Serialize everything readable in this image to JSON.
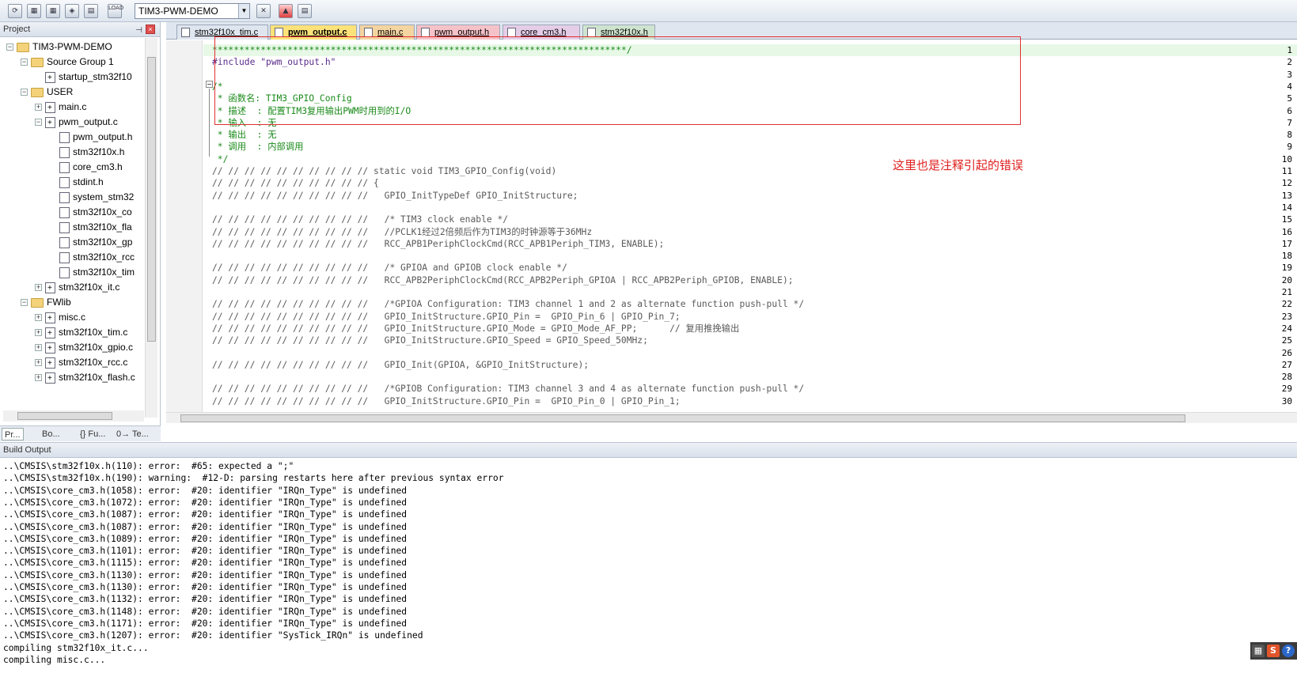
{
  "toolbar": {
    "target": "TIM3-PWM-DEMO",
    "icons": [
      "translate-icon",
      "build-icon",
      "rebuild-icon",
      "batch-build-icon",
      "stop-build-icon",
      "load-icon",
      "options-icon",
      "manage-components-icon",
      "multi-project-icon"
    ],
    "load_label": "LOAD"
  },
  "project_panel": {
    "title": "Project",
    "tree": [
      {
        "label": "TIM3-PWM-DEMO",
        "level": 0,
        "type": "project",
        "exp": "−"
      },
      {
        "label": "Source Group 1",
        "level": 1,
        "type": "folder",
        "exp": "−"
      },
      {
        "label": "startup_stm32f10",
        "level": 2,
        "type": "file",
        "exp": ""
      },
      {
        "label": "USER",
        "level": 1,
        "type": "folder",
        "exp": "−"
      },
      {
        "label": "main.c",
        "level": 2,
        "type": "file",
        "exp": "+"
      },
      {
        "label": "pwm_output.c",
        "level": 2,
        "type": "file",
        "exp": "−"
      },
      {
        "label": "pwm_output.h",
        "level": 3,
        "type": "header",
        "exp": ""
      },
      {
        "label": "stm32f10x.h",
        "level": 3,
        "type": "header",
        "exp": ""
      },
      {
        "label": "core_cm3.h",
        "level": 3,
        "type": "header",
        "exp": ""
      },
      {
        "label": "stdint.h",
        "level": 3,
        "type": "header",
        "exp": ""
      },
      {
        "label": "system_stm32",
        "level": 3,
        "type": "header",
        "exp": ""
      },
      {
        "label": "stm32f10x_co",
        "level": 3,
        "type": "header",
        "exp": ""
      },
      {
        "label": "stm32f10x_fla",
        "level": 3,
        "type": "header",
        "exp": ""
      },
      {
        "label": "stm32f10x_gp",
        "level": 3,
        "type": "header",
        "exp": ""
      },
      {
        "label": "stm32f10x_rcc",
        "level": 3,
        "type": "header",
        "exp": ""
      },
      {
        "label": "stm32f10x_tim",
        "level": 3,
        "type": "header",
        "exp": ""
      },
      {
        "label": "stm32f10x_it.c",
        "level": 2,
        "type": "file",
        "exp": "+"
      },
      {
        "label": "FWlib",
        "level": 1,
        "type": "folder",
        "exp": "−"
      },
      {
        "label": "misc.c",
        "level": 2,
        "type": "file",
        "exp": "+"
      },
      {
        "label": "stm32f10x_tim.c",
        "level": 2,
        "type": "file",
        "exp": "+"
      },
      {
        "label": "stm32f10x_gpio.c",
        "level": 2,
        "type": "file",
        "exp": "+"
      },
      {
        "label": "stm32f10x_rcc.c",
        "level": 2,
        "type": "file",
        "exp": "+"
      },
      {
        "label": "stm32f10x_flash.c",
        "level": 2,
        "type": "file",
        "exp": "+"
      }
    ],
    "bottom_tabs": [
      "Pr...",
      "Bo...",
      "{} Fu...",
      "0→ Te..."
    ]
  },
  "editor_tabs": [
    {
      "label": "stm32f10x_tim.c",
      "active": false,
      "color": "#dfe6ef"
    },
    {
      "label": "pwm_output.c",
      "active": true,
      "color": "#fde27a"
    },
    {
      "label": "main.c",
      "active": false,
      "color": "#f4d4a0"
    },
    {
      "label": "pwm_output.h",
      "active": false,
      "color": "#f5c2c8"
    },
    {
      "label": "core_cm3.h",
      "active": false,
      "color": "#e5cde8"
    },
    {
      "label": "stm32f10x.h",
      "active": false,
      "color": "#cfe4cf"
    }
  ],
  "code_lines": [
    {
      "n": "1",
      "text": "*****************************************************************************/",
      "cls": "c-cm"
    },
    {
      "n": "2",
      "text": "#include \"pwm_output.h\"",
      "cls": "c-pp"
    },
    {
      "n": "3",
      "text": "",
      "cls": ""
    },
    {
      "n": "4",
      "text": "/*",
      "cls": "c-cm"
    },
    {
      "n": "5",
      "text": " * 函数名: TIM3_GPIO_Config",
      "cls": "c-cm"
    },
    {
      "n": "6",
      "text": " * 描述  : 配置TIM3复用输出PWM时用到的I/O",
      "cls": "c-cm"
    },
    {
      "n": "7",
      "text": " * 输入  : 无",
      "cls": "c-cm"
    },
    {
      "n": "8",
      "text": " * 输出  : 无",
      "cls": "c-cm"
    },
    {
      "n": "9",
      "text": " * 调用  : 内部调用",
      "cls": "c-cm"
    },
    {
      "n": "10",
      "text": " */",
      "cls": "c-cm"
    },
    {
      "n": "11",
      "text": "// // // // // // // // // // static void TIM3_GPIO_Config(void)",
      "cls": "c-com"
    },
    {
      "n": "12",
      "text": "// // // // // // // // // // {",
      "cls": "c-com"
    },
    {
      "n": "13",
      "text": "// // // // // // // // // //   GPIO_InitTypeDef GPIO_InitStructure;",
      "cls": "c-com"
    },
    {
      "n": "14",
      "text": "",
      "cls": ""
    },
    {
      "n": "15",
      "text": "// // // // // // // // // //   /* TIM3 clock enable */",
      "cls": "c-com"
    },
    {
      "n": "16",
      "text": "// // // // // // // // // //   //PCLK1经过2倍频后作为TIM3的时钟源等于36MHz",
      "cls": "c-com"
    },
    {
      "n": "17",
      "text": "// // // // // // // // // //   RCC_APB1PeriphClockCmd(RCC_APB1Periph_TIM3, ENABLE);",
      "cls": "c-com"
    },
    {
      "n": "18",
      "text": "",
      "cls": ""
    },
    {
      "n": "19",
      "text": "// // // // // // // // // //   /* GPIOA and GPIOB clock enable */",
      "cls": "c-com"
    },
    {
      "n": "20",
      "text": "// // // // // // // // // //   RCC_APB2PeriphClockCmd(RCC_APB2Periph_GPIOA | RCC_APB2Periph_GPIOB, ENABLE);",
      "cls": "c-com"
    },
    {
      "n": "21",
      "text": "",
      "cls": ""
    },
    {
      "n": "22",
      "text": "// // // // // // // // // //   /*GPIOA Configuration: TIM3 channel 1 and 2 as alternate function push-pull */",
      "cls": "c-com"
    },
    {
      "n": "23",
      "text": "// // // // // // // // // //   GPIO_InitStructure.GPIO_Pin =  GPIO_Pin_6 | GPIO_Pin_7;",
      "cls": "c-com"
    },
    {
      "n": "24",
      "text": "// // // // // // // // // //   GPIO_InitStructure.GPIO_Mode = GPIO_Mode_AF_PP;      // 复用推挽输出",
      "cls": "c-com"
    },
    {
      "n": "25",
      "text": "// // // // // // // // // //   GPIO_InitStructure.GPIO_Speed = GPIO_Speed_50MHz;",
      "cls": "c-com"
    },
    {
      "n": "26",
      "text": "",
      "cls": ""
    },
    {
      "n": "27",
      "text": "// // // // // // // // // //   GPIO_Init(GPIOA, &GPIO_InitStructure);",
      "cls": "c-com"
    },
    {
      "n": "28",
      "text": "",
      "cls": ""
    },
    {
      "n": "29",
      "text": "// // // // // // // // // //   /*GPIOB Configuration: TIM3 channel 3 and 4 as alternate function push-pull */",
      "cls": "c-com"
    },
    {
      "n": "30",
      "text": "// // // // // // // // // //   GPIO_InitStructure.GPIO_Pin =  GPIO_Pin_0 | GPIO_Pin_1;",
      "cls": "c-com"
    }
  ],
  "annotation": "这里也是注释引起的错误",
  "build_output": {
    "title": "Build Output",
    "lines": [
      "..\\CMSIS\\stm32f10x.h(110): error:  #65: expected a \";\"",
      "..\\CMSIS\\stm32f10x.h(190): warning:  #12-D: parsing restarts here after previous syntax error",
      "..\\CMSIS\\core_cm3.h(1058): error:  #20: identifier \"IRQn_Type\" is undefined",
      "..\\CMSIS\\core_cm3.h(1072): error:  #20: identifier \"IRQn_Type\" is undefined",
      "..\\CMSIS\\core_cm3.h(1087): error:  #20: identifier \"IRQn_Type\" is undefined",
      "..\\CMSIS\\core_cm3.h(1087): error:  #20: identifier \"IRQn_Type\" is undefined",
      "..\\CMSIS\\core_cm3.h(1089): error:  #20: identifier \"IRQn_Type\" is undefined",
      "..\\CMSIS\\core_cm3.h(1101): error:  #20: identifier \"IRQn_Type\" is undefined",
      "..\\CMSIS\\core_cm3.h(1115): error:  #20: identifier \"IRQn_Type\" is undefined",
      "..\\CMSIS\\core_cm3.h(1130): error:  #20: identifier \"IRQn_Type\" is undefined",
      "..\\CMSIS\\core_cm3.h(1130): error:  #20: identifier \"IRQn_Type\" is undefined",
      "..\\CMSIS\\core_cm3.h(1132): error:  #20: identifier \"IRQn_Type\" is undefined",
      "..\\CMSIS\\core_cm3.h(1148): error:  #20: identifier \"IRQn_Type\" is undefined",
      "..\\CMSIS\\core_cm3.h(1171): error:  #20: identifier \"IRQn_Type\" is undefined",
      "..\\CMSIS\\core_cm3.h(1207): error:  #20: identifier \"SysTick_IRQn\" is undefined",
      "compiling stm32f10x_it.c...",
      "compiling misc.c..."
    ]
  },
  "tray": {
    "icons": [
      "keyboard-icon",
      "sogou-s-icon",
      "help-icon"
    ],
    "s_label": "S",
    "help_label": "?"
  }
}
